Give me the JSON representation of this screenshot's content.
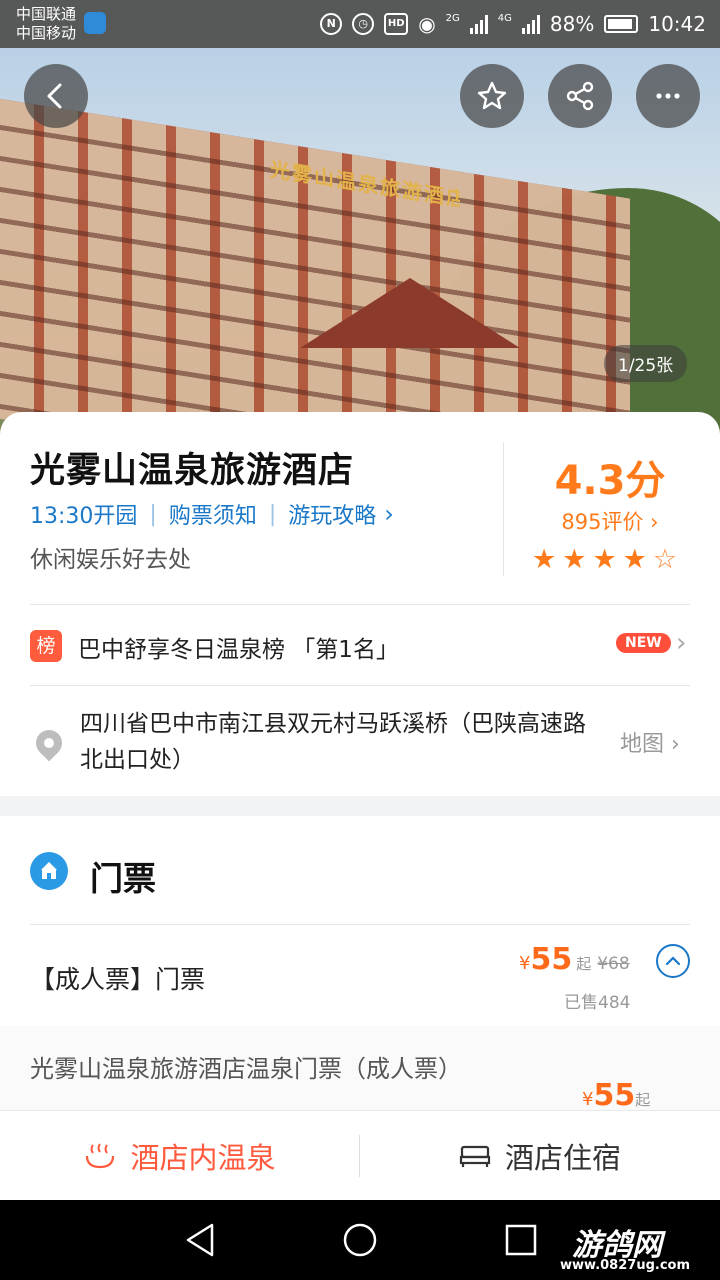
{
  "status_bar": {
    "carrier_1": "中国联通",
    "carrier_2": "中国移动",
    "network_1": "2G",
    "network_2": "4G",
    "battery": "88%",
    "time": "10:42"
  },
  "hero": {
    "photo_sign": "光雾山温泉旅游酒店",
    "photo_counter": "1/25张",
    "buttons": [
      "back-icon",
      "star-icon",
      "share-icon",
      "more-icon"
    ]
  },
  "info": {
    "name": "光雾山温泉旅游酒店",
    "open_time": "13:30开园",
    "ticket_notice": "购票须知",
    "guide": "游玩攻略",
    "guide_chevron": "›",
    "slogan": "休闲娱乐好去处",
    "score": "4.3分",
    "reviews": "895评价 ›",
    "rating_stars": 4,
    "rating_max": 5
  },
  "rank": {
    "tag": "榜",
    "text": "巴中舒享冬日温泉榜 「第1名」",
    "badge": "NEW",
    "chevron": "›"
  },
  "location": {
    "address": "四川省巴中市南江县双元村马跃溪桥（巴陕高速路北出口处）",
    "map_link": "地图 ›"
  },
  "tickets": {
    "section_title": "门票",
    "item_name": "【成人票】门票",
    "currency": "¥",
    "price": "55",
    "from": "起",
    "original_price": "¥68",
    "sold": "已售484",
    "sub_item_name": "光雾山温泉旅游酒店温泉门票（成人票）",
    "sub_price": "55",
    "sub_from": "起"
  },
  "bottom_tabs": {
    "tab_1": "酒店内温泉",
    "tab_2": "酒店住宿"
  },
  "watermark": {
    "logo": "游鸽网",
    "url": "www.0827ug.com"
  },
  "colors": {
    "accent_orange": "#ff7a1a",
    "link_blue": "#1a78c8",
    "tab_active": "#ff5a3d"
  }
}
